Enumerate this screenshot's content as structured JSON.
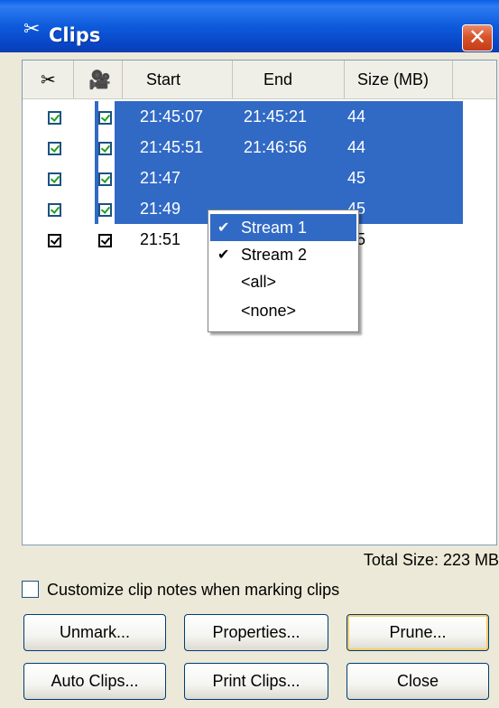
{
  "window": {
    "title": "Clips",
    "title_icon": "scissors-icon",
    "close_label": "✕"
  },
  "table": {
    "headers": {
      "col_cut_icon": "scissors-icon",
      "col_stream_icon": "camera-icon",
      "start": "Start",
      "end": "End",
      "size": "Size (MB)"
    },
    "rows": [
      {
        "start": "21:45:07",
        "end": "21:45:21",
        "size": "44",
        "selected": true
      },
      {
        "start": "21:45:51",
        "end": "21:46:56",
        "size": "44",
        "selected": true
      },
      {
        "start": "21:47",
        "end": "",
        "size": "45",
        "selected": true
      },
      {
        "start": "21:49",
        "end": "",
        "size": "45",
        "selected": true
      },
      {
        "start": "21:51",
        "end": "",
        "size": "45",
        "selected": false
      }
    ]
  },
  "context_menu": {
    "items": [
      {
        "label": "Stream 1",
        "checked": true,
        "highlighted": true
      },
      {
        "label": "Stream 2",
        "checked": true,
        "highlighted": false
      },
      {
        "label": "<all>",
        "checked": false,
        "highlighted": false
      },
      {
        "label": "<none>",
        "checked": false,
        "highlighted": false
      }
    ]
  },
  "footer": {
    "total_size": "Total Size: 223 MB",
    "customize_label": "Customize clip notes when marking clips",
    "customize_checked": false
  },
  "buttons": {
    "unmark": "Unmark...",
    "properties": "Properties...",
    "prune": "Prune...",
    "auto_clips": "Auto Clips...",
    "print_clips": "Print Clips...",
    "close": "Close"
  },
  "colors": {
    "selection": "#316ac5",
    "titlebar": "#0d5bdc",
    "dialog_bg": "#ece9d8"
  }
}
